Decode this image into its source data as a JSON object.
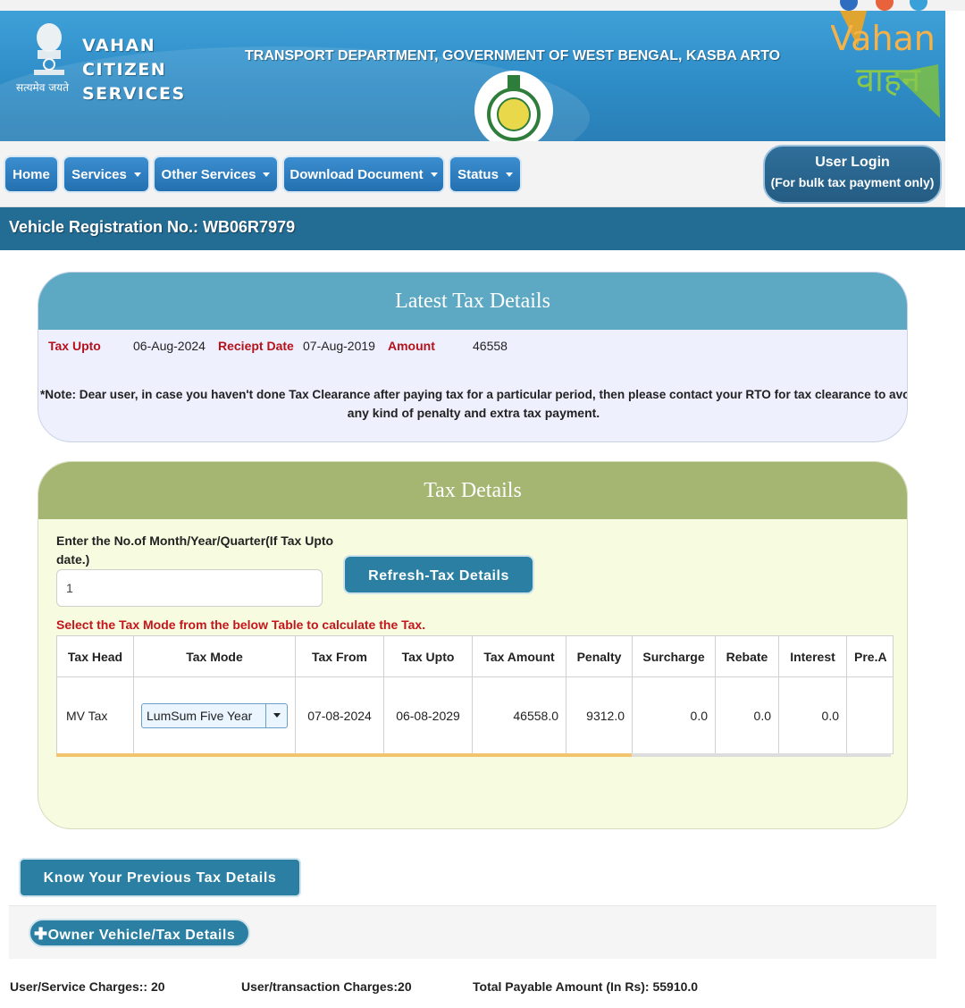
{
  "header": {
    "app_name": "VAHAN CITIZEN SERVICES",
    "emblem_caption": "सत्यमेव जयते",
    "department": "TRANSPORT DEPARTMENT, GOVERNMENT OF WEST BENGAL, KASBA ARTO",
    "logo_text_en": "Vahan",
    "logo_text_hi": "वाहन"
  },
  "nav": {
    "home": "Home",
    "services": "Services",
    "other_services": "Other Services",
    "download_document": "Download Document",
    "status": "Status",
    "login_title": "User Login",
    "login_sub": "(For bulk tax payment only)"
  },
  "registration": {
    "text": "Vehicle Registration No.: WB06R7979"
  },
  "latest_tax": {
    "title": "Latest Tax Details",
    "tax_upto_label": "Tax Upto",
    "tax_upto_value": "06-Aug-2024",
    "receipt_date_label": "Reciept Date",
    "receipt_date_value": "07-Aug-2019",
    "amount_label": "Amount",
    "amount_value": "46558",
    "note_line1": "*Note: Dear user, in case you haven't done Tax Clearance after paying tax for a particular period, then please contact your RTO for tax clearance to avoid",
    "note_line2": "any kind of penalty and extra tax payment."
  },
  "tax_details": {
    "title": "Tax Details",
    "months_label": "Enter the No.of Month/Year/Quarter(If Tax Upto date.)",
    "months_value": "1",
    "refresh_button": "Refresh-Tax Details",
    "mode_hint": "Select the Tax Mode from the below Table to calculate the Tax.",
    "columns": {
      "tax_head": "Tax Head",
      "tax_mode": "Tax Mode",
      "tax_from": "Tax From",
      "tax_upto": "Tax Upto",
      "tax_amount": "Tax Amount",
      "penalty": "Penalty",
      "surcharge": "Surcharge",
      "rebate": "Rebate",
      "interest": "Interest",
      "pre_adj": "Pre.A"
    },
    "row": {
      "tax_head": "MV Tax",
      "tax_mode": "LumSum Five Year",
      "tax_from": "07-08-2024",
      "tax_upto": "06-08-2029",
      "tax_amount": "46558.0",
      "penalty": "9312.0",
      "surcharge": "0.0",
      "rebate": "0.0",
      "interest": "0.0",
      "pre_adj": ""
    }
  },
  "bottom": {
    "prev_tax_button": "Know Your Previous Tax Details",
    "owner_button": "Owner Vehicle/Tax Details",
    "service_charges": "User/Service Charges:: 20",
    "transaction_charges": "User/transaction Charges:20",
    "total_payable": "Total Payable Amount (In Rs): 55910.0"
  },
  "colors": {
    "header_blue": "#2e8cc6",
    "nav_blue": "#2f7fc0",
    "regbar": "#236c93",
    "latest_header": "#5da8c3",
    "tax_header": "#a4b672",
    "label_red": "#b5121b"
  }
}
